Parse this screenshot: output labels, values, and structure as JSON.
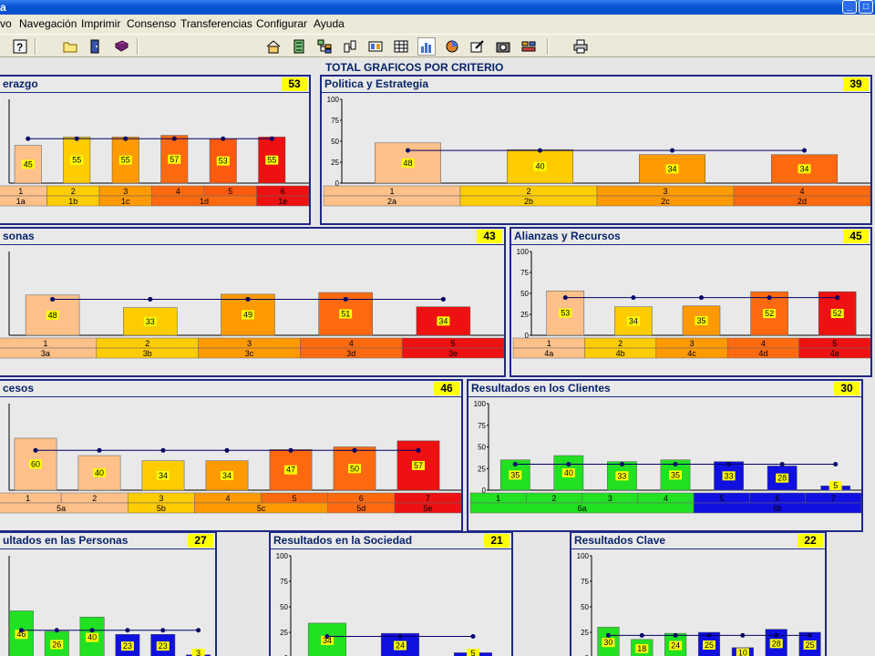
{
  "window": {
    "title": "a",
    "minimize_label": "_",
    "maximize_label": "□"
  },
  "menu": [
    "vo",
    "Navegación",
    "Imprimir",
    "Consenso",
    "Transferencias",
    "Configurar",
    "Ayuda"
  ],
  "toolbar": {
    "icons": [
      "help-icon",
      "folder-icon",
      "door-icon",
      "book-icon",
      "home-icon",
      "list-icon",
      "tree-icon",
      "cards-icon",
      "frame-icon",
      "grid-icon",
      "bar-chart-icon",
      "pie-chart-icon",
      "edit-chart-icon",
      "camera-icon",
      "tools-icon",
      "printer-icon"
    ],
    "active": "bar-chart-icon"
  },
  "page": {
    "title": "TOTAL GRAFICOS POR CRITERIO"
  },
  "colors": {
    "c1": "#FFC08A",
    "c2": "#FFCC00",
    "c3": "#FF9A00",
    "c4": "#FF6A10",
    "c5": "#FF5A10",
    "c6": "#EE1111",
    "green": "#22E022",
    "blue": "#1010E0",
    "line": "#000066",
    "score_bg": "#FFFF00",
    "border": "#1E2A86"
  },
  "chart_data": [
    {
      "type": "bar",
      "title": "erazgo",
      "score": "53",
      "ylim": [
        0,
        100
      ],
      "yticks": [],
      "values": [
        45,
        55,
        55,
        57,
        53,
        55
      ],
      "line_value": 53,
      "colors": [
        "c1",
        "c2",
        "c3",
        "c4",
        "c5",
        "c6"
      ],
      "row1": [
        "1",
        "2",
        "3",
        "4",
        "5",
        "6"
      ],
      "row2": [
        [
          "1a",
          1
        ],
        [
          "1b",
          1
        ],
        [
          "1c",
          1
        ],
        [
          "1d",
          2
        ],
        [
          "1e",
          1
        ]
      ],
      "row2_colors": [
        "c1",
        "c2",
        "c3",
        "c4",
        "c6"
      ]
    },
    {
      "type": "bar",
      "title": "Politica y Estrategia",
      "score": "39",
      "ylim": [
        0,
        100
      ],
      "yticks": [
        "100",
        "75",
        "50",
        "25",
        "0"
      ],
      "values": [
        48,
        40,
        34,
        34
      ],
      "line_value": 39,
      "colors": [
        "c1",
        "c2",
        "c3",
        "c4"
      ],
      "row1": [
        "1",
        "2",
        "3",
        "4"
      ],
      "row2": [
        [
          "2a",
          1
        ],
        [
          "2b",
          1
        ],
        [
          "2c",
          1
        ],
        [
          "2d",
          1
        ]
      ],
      "row2_colors": [
        "c1",
        "c2",
        "c3",
        "c4"
      ]
    },
    {
      "type": "bar",
      "title": "sonas",
      "score": "43",
      "ylim": [
        0,
        100
      ],
      "yticks": [],
      "values": [
        48,
        33,
        49,
        51,
        34
      ],
      "line_value": 43,
      "colors": [
        "c1",
        "c2",
        "c3",
        "c4",
        "c6"
      ],
      "row1": [
        "1",
        "2",
        "3",
        "4",
        "5"
      ],
      "row2": [
        [
          "3a",
          1
        ],
        [
          "3b",
          1
        ],
        [
          "3c",
          1
        ],
        [
          "3d",
          1
        ],
        [
          "3e",
          1
        ]
      ],
      "row2_colors": [
        "c1",
        "c2",
        "c3",
        "c4",
        "c6"
      ]
    },
    {
      "type": "bar",
      "title": "Alianzas y Recursos",
      "score": "45",
      "ylim": [
        0,
        100
      ],
      "yticks": [
        "100",
        "75",
        "50",
        "25",
        "0"
      ],
      "values": [
        53,
        34,
        35,
        52,
        52
      ],
      "line_value": 45,
      "colors": [
        "c1",
        "c2",
        "c3",
        "c4",
        "c6"
      ],
      "row1": [
        "1",
        "2",
        "3",
        "4",
        "5"
      ],
      "row2": [
        [
          "4a",
          1
        ],
        [
          "4b",
          1
        ],
        [
          "4c",
          1
        ],
        [
          "4d",
          1
        ],
        [
          "4e",
          1
        ]
      ],
      "row2_colors": [
        "c1",
        "c2",
        "c3",
        "c4",
        "c6"
      ]
    },
    {
      "type": "bar",
      "title": "cesos",
      "score": "46",
      "ylim": [
        0,
        100
      ],
      "yticks": [],
      "values": [
        60,
        40,
        34,
        34,
        47,
        50,
        57
      ],
      "line_value": 46,
      "colors": [
        "c1",
        "c1",
        "c2",
        "c3",
        "c4",
        "c4",
        "c6"
      ],
      "row1": [
        "1",
        "2",
        "3",
        "4",
        "5",
        "6",
        "7"
      ],
      "row2": [
        [
          "5a",
          2
        ],
        [
          "5b",
          1
        ],
        [
          "5c",
          2
        ],
        [
          "5d",
          1
        ],
        [
          "5e",
          1
        ]
      ],
      "row2_colors": [
        "c1",
        "c2",
        "c3",
        "c4",
        "c6"
      ]
    },
    {
      "type": "bar",
      "title": "Resultados en los Clientes",
      "score": "30",
      "ylim": [
        0,
        100
      ],
      "yticks": [
        "100",
        "75",
        "50",
        "25",
        "0"
      ],
      "values": [
        35,
        40,
        33,
        35,
        33,
        28,
        5
      ],
      "line_value": 30,
      "colors": [
        "green",
        "green",
        "green",
        "green",
        "blue",
        "blue",
        "blue"
      ],
      "row1": [
        "1",
        "2",
        "3",
        "4",
        "5",
        "6",
        "7"
      ],
      "row2": [
        [
          "6a",
          4
        ],
        [
          "6b",
          3
        ]
      ],
      "row2_colors": [
        "green",
        "blue"
      ]
    },
    {
      "type": "bar",
      "title": "ultados en las Personas",
      "score": "27",
      "ylim": [
        0,
        100
      ],
      "yticks": [],
      "values": [
        46,
        26,
        40,
        23,
        23,
        3
      ],
      "line_value": 27,
      "colors": [
        "green",
        "green",
        "green",
        "blue",
        "blue",
        "blue"
      ],
      "row1": [],
      "row2": [],
      "row2_colors": []
    },
    {
      "type": "bar",
      "title": "Resultados en la Sociedad",
      "score": "21",
      "ylim": [
        0,
        100
      ],
      "yticks": [
        "100",
        "75",
        "50",
        "25",
        "0"
      ],
      "values": [
        34,
        24,
        5
      ],
      "line_value": 21,
      "colors": [
        "green",
        "blue",
        "blue"
      ],
      "row1": [],
      "row2": [],
      "row2_colors": []
    },
    {
      "type": "bar",
      "title": "Resultados Clave",
      "score": "22",
      "ylim": [
        0,
        100
      ],
      "yticks": [
        "100",
        "75",
        "50",
        "25",
        "0"
      ],
      "values": [
        30,
        18,
        24,
        25,
        10,
        28,
        25
      ],
      "line_value": 22,
      "colors": [
        "green",
        "green",
        "green",
        "blue",
        "blue",
        "blue",
        "blue"
      ],
      "row1": [],
      "row2": [],
      "row2_colors": []
    }
  ]
}
